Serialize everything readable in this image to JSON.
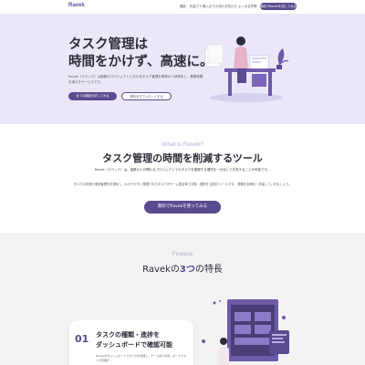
{
  "header": {
    "logo": "Ravek",
    "nav": [
      "機能",
      "料金プラン",
      "導入までの流れ",
      "お知らせ",
      "よくある質問"
    ],
    "cta": "無料でRavekを試してみる"
  },
  "hero": {
    "title": "タスク管理は\n時間をかけず、高速に。",
    "description": "Ravek（ラベック）は複数のプロジェクトにおけるタスク管理を簡単かつ効率化し、業務時間を減らすサービスです。",
    "primary_button": "全ての機能を試してみる",
    "secondary_button": "資料をダウンロードする"
  },
  "about": {
    "eyebrow": "What is Ravek?",
    "title": "タスク管理の時間を削減するツール",
    "subtitle": "Ravek（ラベック）は、複数の人が関わるプロジェクトでのタスクを管理する環境を一元化して共有することが可能です。",
    "body": "タスクの状態や進捗管理を可視化し、わかりやすく整理されたタスクがチーム間全体で共有・連携を 目指すツールです。 業務を効率化・改善していきましょう。",
    "button": "無料でRavekを使ってみる"
  },
  "feature": {
    "eyebrow": "Feature",
    "title_prefix": "Ravekの",
    "title_accent": "3つ",
    "title_suffix": "の特長",
    "item": {
      "number": "01",
      "heading": "タスクの種類・進捗を\nダッシュボードで確認可能",
      "text": "Ravekのダッシュボードでタスクを管理し、チーム間で共有。ボードでタスク管理が..."
    }
  },
  "colors": {
    "accent": "#5a4a8f",
    "hero_bg": "#ebe7f8",
    "feature_bg": "#f3f3f3"
  }
}
